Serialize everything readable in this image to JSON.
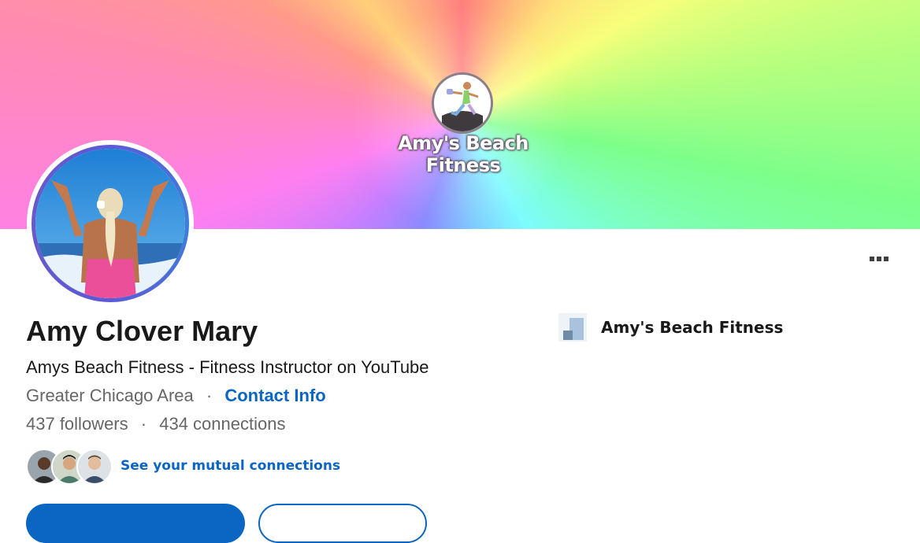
{
  "banner": {
    "title": "Amy's Beach Fitness",
    "logo_icon": "fitness-woman-logo"
  },
  "profile": {
    "name": "Amy Clover Mary",
    "headline": "Amys Beach Fitness - Fitness Instructor on YouTube",
    "location": "Greater Chicago Area",
    "separator": "·",
    "contact_info_label": "Contact Info",
    "followers": "437 followers",
    "connections": "434 connections",
    "mutual_connections_label": "See your mutual connections"
  },
  "company": {
    "name": "Amy's Beach Fitness",
    "logo_icon": "company-placeholder-icon"
  },
  "actions": {
    "more_icon": "ellipsis-icon",
    "primary_button": "",
    "secondary_button": ""
  },
  "colors": {
    "link_blue": "#0a66c2",
    "text_primary": "#191919",
    "text_secondary": "#666666"
  }
}
